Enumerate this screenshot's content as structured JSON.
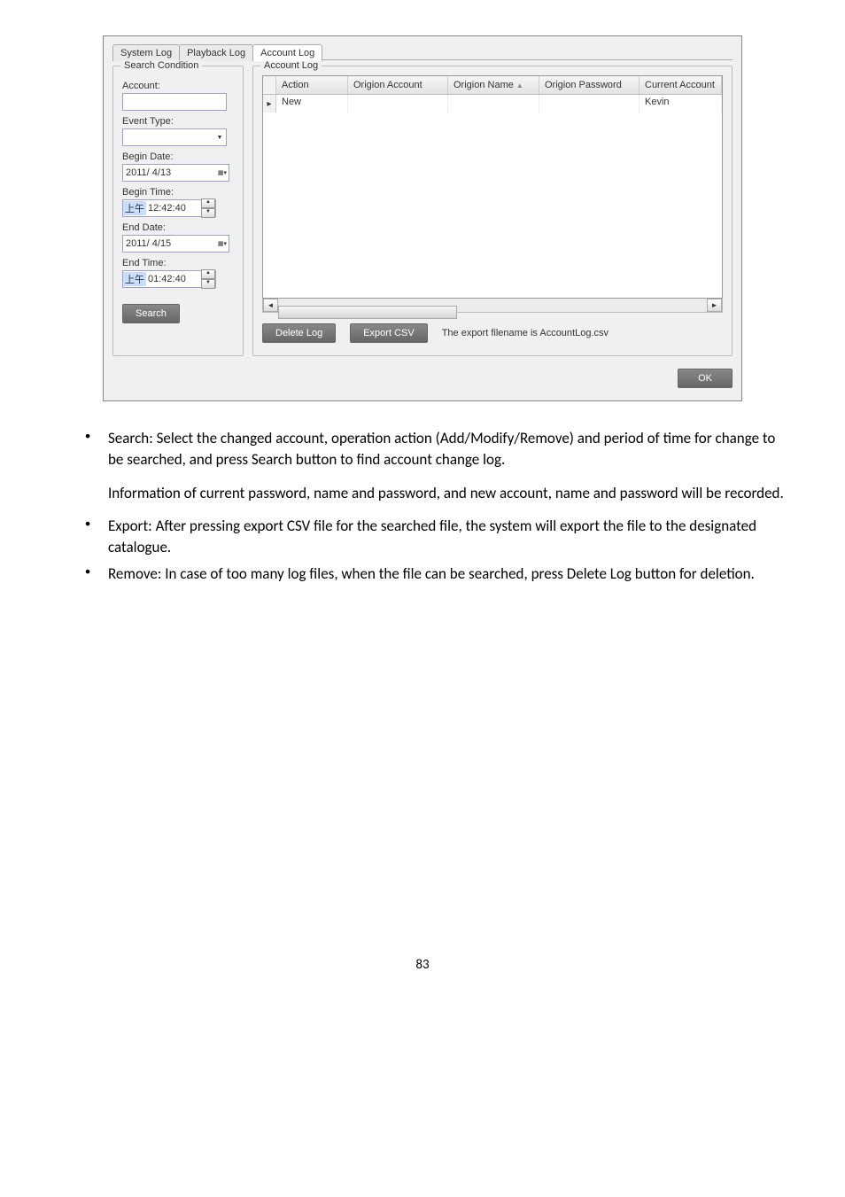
{
  "dialog": {
    "tabs": {
      "t1": "System Log",
      "t2": "Playback Log",
      "t3": "Account Log"
    },
    "left": {
      "group_title": "Search Condition",
      "account_label": "Account:",
      "account_value": "",
      "event_type_label": "Event Type:",
      "begin_date_label": "Begin Date:",
      "begin_date_value": "2011/ 4/13",
      "begin_time_label": "Begin Time:",
      "begin_time_prefix": "上午",
      "begin_time_rest": "12:42:40",
      "end_date_label": "End Date:",
      "end_date_value": "2011/ 4/15",
      "end_time_label": "End Time:",
      "end_time_prefix": "上午",
      "end_time_rest": "01:42:40",
      "search_btn": "Search"
    },
    "right": {
      "group_title": "Account Log",
      "cols": {
        "action": "Action",
        "oacct": "Origion Account",
        "oname": "Origion Name",
        "opass": "Origion Password",
        "cacct": "Current Account"
      },
      "row_action": "New",
      "row_cacct": "Kevin",
      "delete_btn": "Delete Log",
      "export_btn": "Export CSV",
      "export_note": "The export filename is AccountLog.csv"
    },
    "ok_btn": "OK"
  },
  "text": {
    "bullet1": "Search: Select the changed account, operation action (Add/Modify/Remove) and period of time for change to be searched, and press Search button to find account change log.",
    "para": "Information of current password, name and password, and new account, name and password will be recorded.",
    "bullet2": "Export: After pressing export CSV file for the searched file, the system will export the file to the designated catalogue.",
    "bullet3": "Remove: In case of too many log files, when the file can be searched, press Delete Log button for deletion.",
    "page": "83"
  }
}
